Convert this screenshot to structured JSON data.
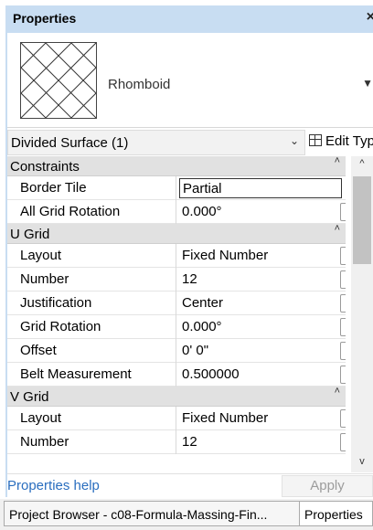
{
  "title": "Properties",
  "close_glyph": "×",
  "type_selector": {
    "name": "Rhomboid",
    "caret": "▼"
  },
  "instance_selector": {
    "label": "Divided Surface (1)",
    "chevron": "⌄",
    "edit_type": "Edit Type"
  },
  "groups": [
    {
      "label": "Constraints",
      "rows": [
        {
          "name": "Border Tile",
          "value": "Partial",
          "editing": true
        },
        {
          "name": "All Grid Rotation",
          "value": "0.000°"
        }
      ]
    },
    {
      "label": "U Grid",
      "rows": [
        {
          "name": "Layout",
          "value": "Fixed Number"
        },
        {
          "name": "Number",
          "value": "12"
        },
        {
          "name": "Justification",
          "value": "Center"
        },
        {
          "name": "Grid Rotation",
          "value": "0.000°"
        },
        {
          "name": "Offset",
          "value": "0'  0\""
        },
        {
          "name": "Belt Measurement",
          "value": "0.500000"
        }
      ]
    },
    {
      "label": "V Grid",
      "rows": [
        {
          "name": "Layout",
          "value": "Fixed Number"
        },
        {
          "name": "Number",
          "value": "12"
        }
      ]
    }
  ],
  "collapse_glyph": "˄",
  "scroll": {
    "up": "^",
    "down": "v"
  },
  "help_link": "Properties help",
  "apply_label": "Apply",
  "tabs": {
    "project_browser": "Project Browser - c08-Formula-Massing-Fin...",
    "properties": "Properties"
  },
  "colors": {
    "title_bar": "#c8ddf2",
    "group_header": "#e1e1e1",
    "link": "#2a6ebf",
    "apply_disabled_text": "#9c9c9c"
  }
}
